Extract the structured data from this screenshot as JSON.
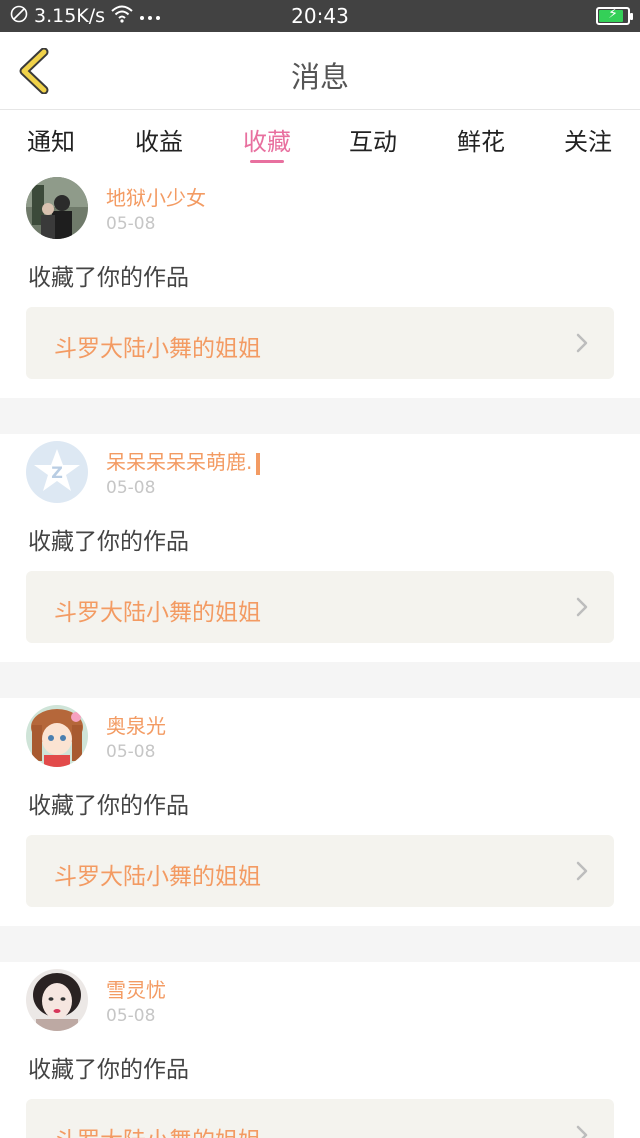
{
  "status_bar": {
    "network_speed": "3.15K/s",
    "time": "20:43",
    "battery_level": 0.85
  },
  "header": {
    "title": "消息"
  },
  "tabs": [
    {
      "label": "通知"
    },
    {
      "label": "收益"
    },
    {
      "label": "收藏"
    },
    {
      "label": "互动"
    },
    {
      "label": "鲜花"
    },
    {
      "label": "关注"
    }
  ],
  "active_tab": "收藏",
  "messages": [
    {
      "username": "地狱小少女",
      "date": "05-08",
      "action": "收藏了你的作品",
      "work_title": "斗罗大陆小舞的姐姐",
      "avatar_icon": "photo-avatar-dark"
    },
    {
      "username": "呆呆呆呆呆萌鹿.",
      "date": "05-08",
      "action": "收藏了你的作品",
      "work_title": "斗罗大陆小舞的姐姐",
      "avatar_icon": "qq-default-avatar"
    },
    {
      "username": "奥泉光",
      "date": "05-08",
      "action": "收藏了你的作品",
      "work_title": "斗罗大陆小舞的姐姐",
      "avatar_icon": "anime-girl-avatar"
    },
    {
      "username": "雪灵忧",
      "date": "05-08",
      "action": "收藏了你的作品",
      "work_title": "斗罗大陆小舞的姐姐",
      "avatar_icon": "photo-avatar-girl"
    }
  ],
  "colors": {
    "accent": "#e8709f",
    "username": "#f39b63",
    "back_arrow": "#f0d24a",
    "card_bg": "#f4f3ee"
  }
}
